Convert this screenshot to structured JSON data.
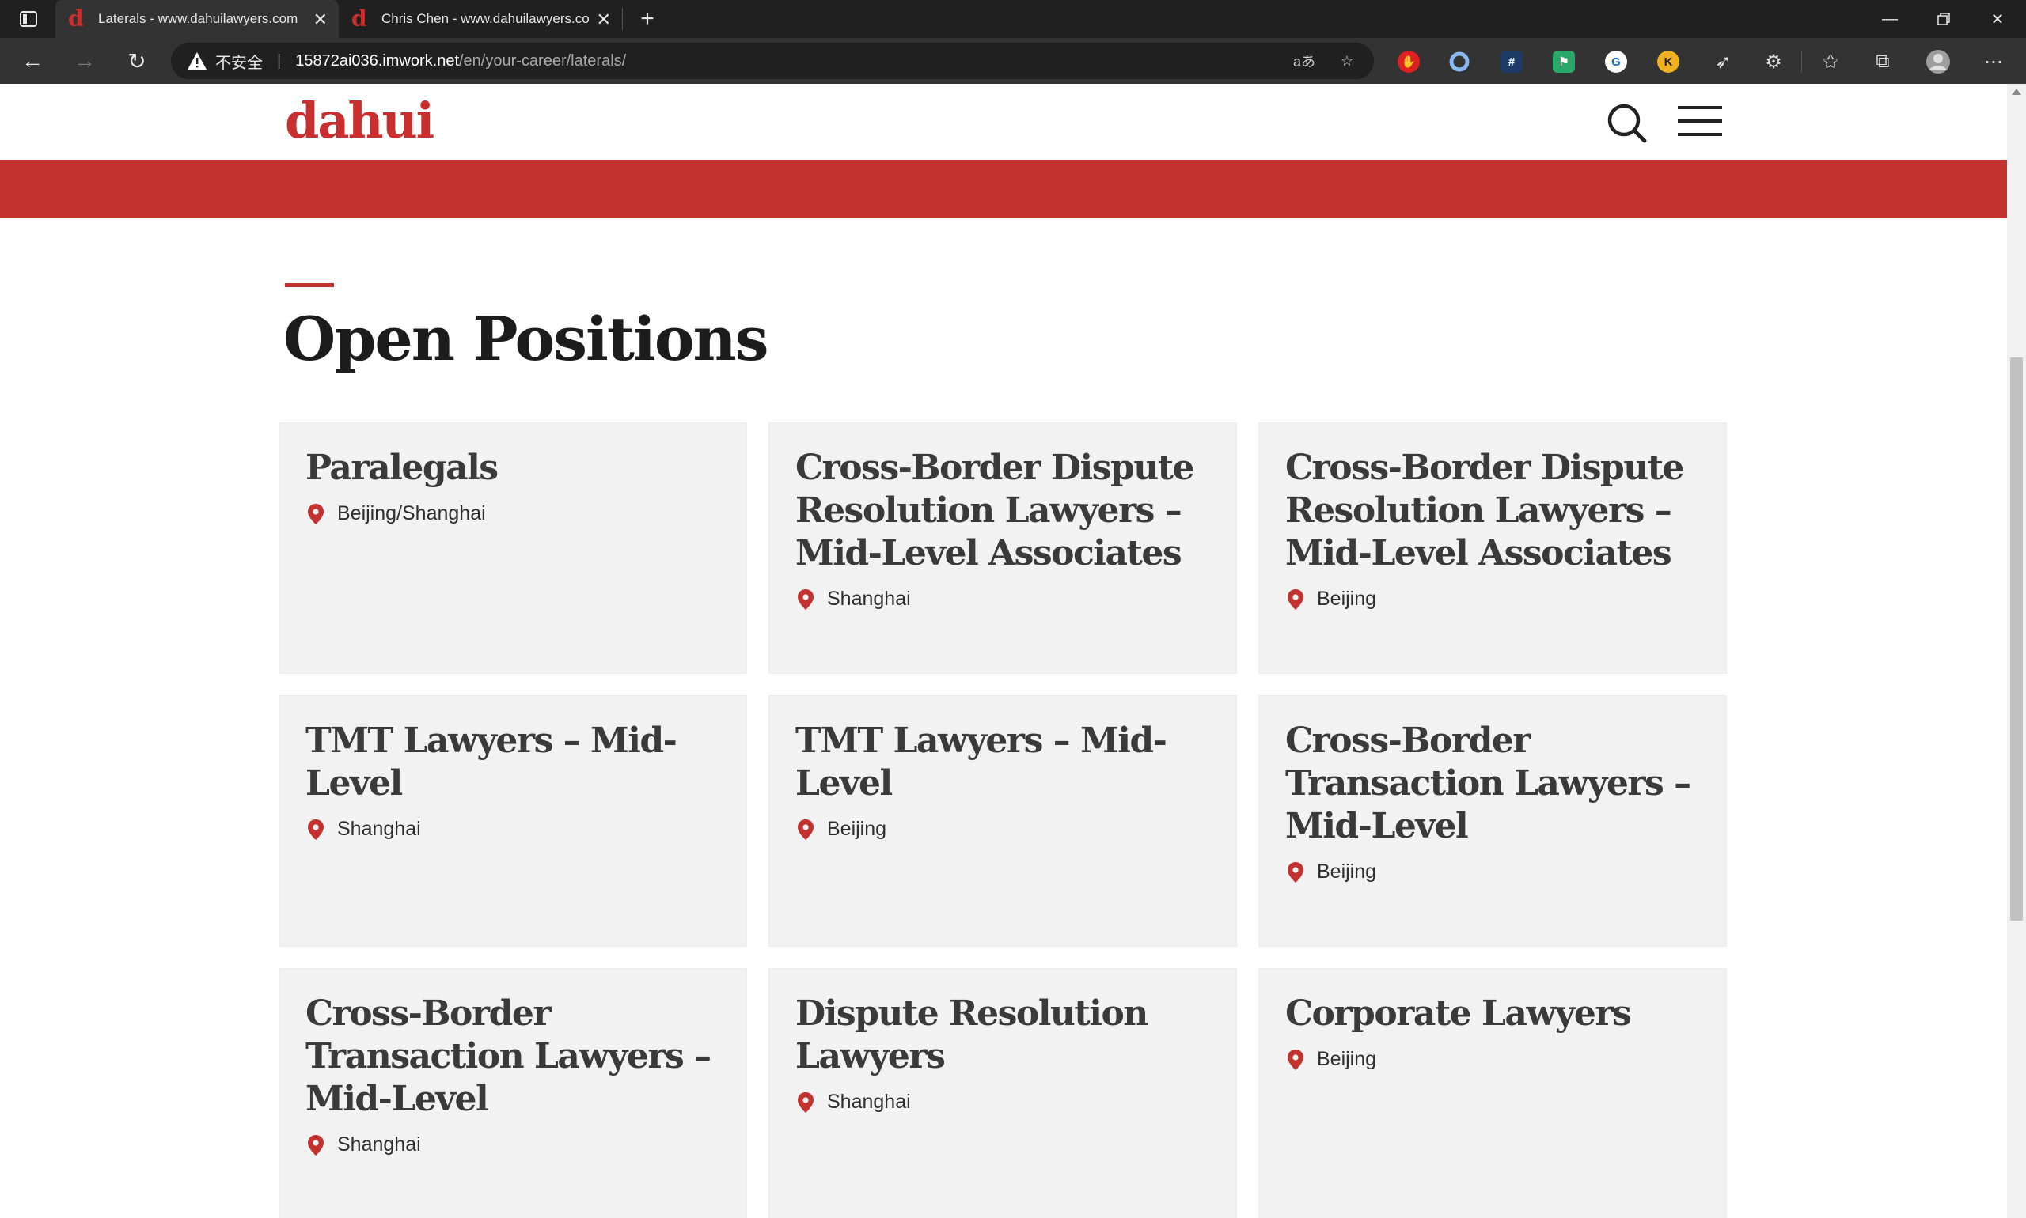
{
  "browser": {
    "tabs": [
      {
        "title": "Laterals - www.dahuilawyers.com",
        "favicon": "d",
        "active": true
      },
      {
        "title": "Chris Chen - www.dahuilawyers.com",
        "favicon": "d",
        "active": false
      }
    ],
    "address": {
      "security_label": "不安全",
      "host": "15872ai036.imwork.net",
      "path": "/en/your-career/laterals/"
    },
    "extension_icons": [
      "adblock-icon",
      "circle-extension-icon",
      "hash-extension-icon",
      "flag-extension-icon",
      "globe-extension-icon",
      "k-extension-icon"
    ],
    "colors": {
      "chrome_dark": "#202020",
      "toolbar": "#333333"
    }
  },
  "site": {
    "logo": "dahui",
    "colors": {
      "brand_red": "#c4322f",
      "card_bg": "#f2f2f2"
    }
  },
  "section": {
    "title": "Open Positions"
  },
  "positions": [
    {
      "title": "Paralegals",
      "location": "Beijing/Shanghai"
    },
    {
      "title": "Cross-Border Dispute Resolution Lawyers – Mid-Level Associates",
      "location": "Shanghai"
    },
    {
      "title": "Cross-Border Dispute Resolution Lawyers – Mid-Level Associates",
      "location": "Beijing"
    },
    {
      "title": "TMT Lawyers – Mid-Level",
      "location": "Shanghai"
    },
    {
      "title": "TMT Lawyers – Mid-Level",
      "location": "Beijing"
    },
    {
      "title": "Cross-Border Transaction Lawyers – Mid-Level",
      "location": "Beijing"
    },
    {
      "title": "Cross-Border Transaction Lawyers – Mid-Level",
      "location": "Shanghai"
    },
    {
      "title": "Dispute Resolution Lawyers",
      "location": "Shanghai"
    },
    {
      "title": "Corporate Lawyers",
      "location": "Beijing"
    }
  ]
}
